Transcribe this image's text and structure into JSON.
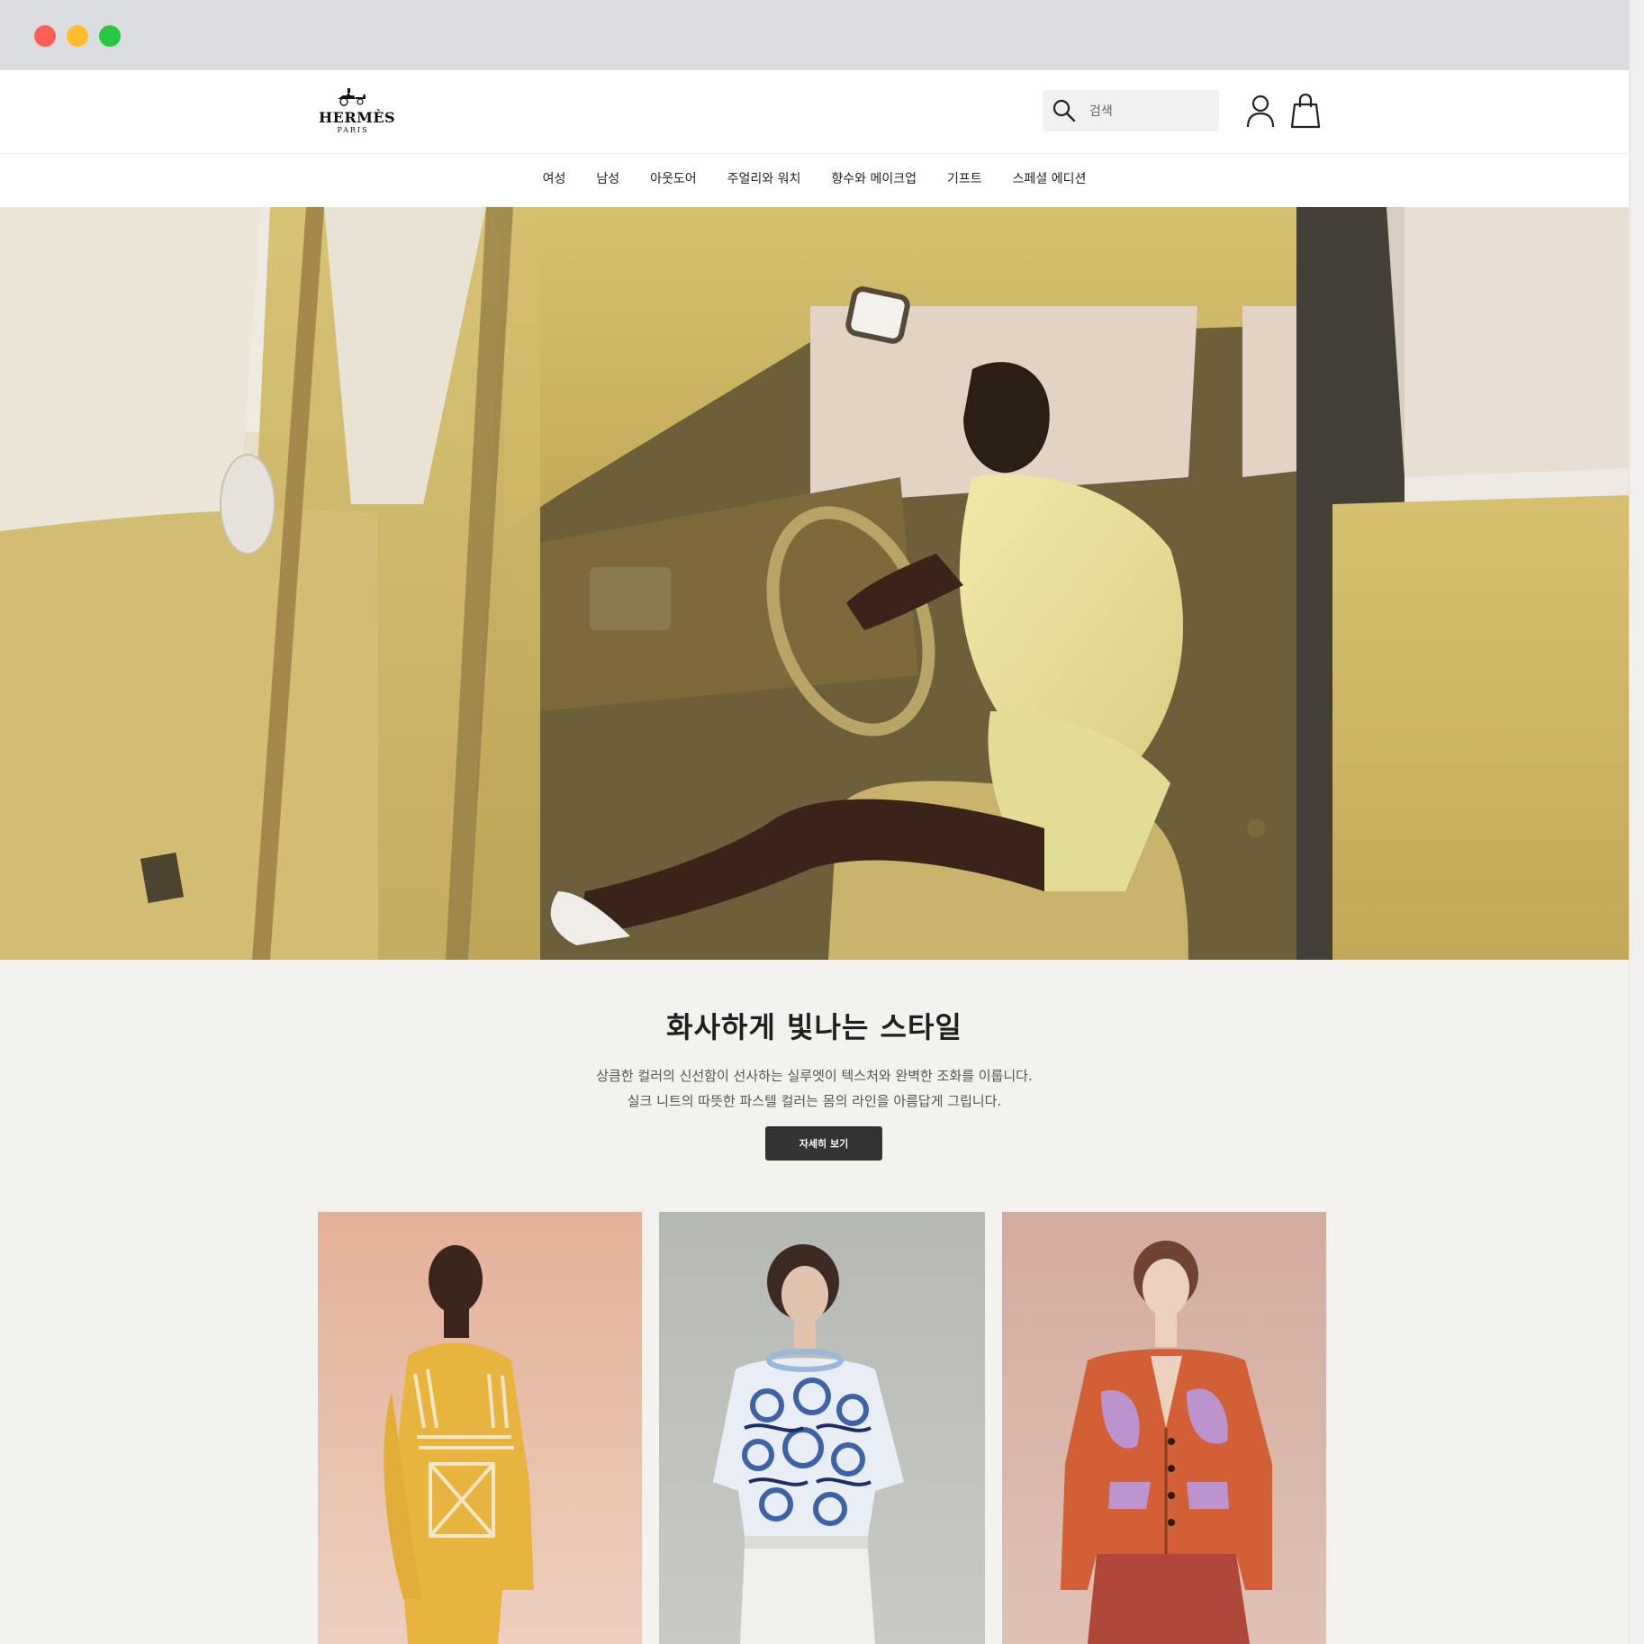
{
  "window": {
    "traffic_lights": [
      "close",
      "minimize",
      "zoom"
    ]
  },
  "header": {
    "logo_text": "HERMÈS",
    "logo_sub": "PARIS",
    "search_placeholder": "검색",
    "icons": [
      "search-icon",
      "account-icon",
      "shopping-bag-icon"
    ]
  },
  "nav": {
    "items": [
      "여성",
      "남성",
      "아웃도어",
      "주얼리와 워치",
      "향수와 메이크업",
      "기프트",
      "스페셜 에디션"
    ]
  },
  "promo": {
    "title": "화사하게 빛나는 스타일",
    "lines": [
      "상큼한 컬러의 신선함이 선사하는 실루엣이 텍스처와 완벽한 조화를 이룹니다.",
      "실크 니트의 따뜻한 파스텔 컬러는 몸의 라인을 아름답게 그립니다."
    ],
    "cta_label": "자세히 보기"
  },
  "colors": {
    "accent_dark": "#333333",
    "car_yellow": "#cfb765",
    "card_bg_1": "#e8bca6",
    "card_bg_2": "#bfc1bb",
    "card_bg_3": "#d9b2a5"
  }
}
